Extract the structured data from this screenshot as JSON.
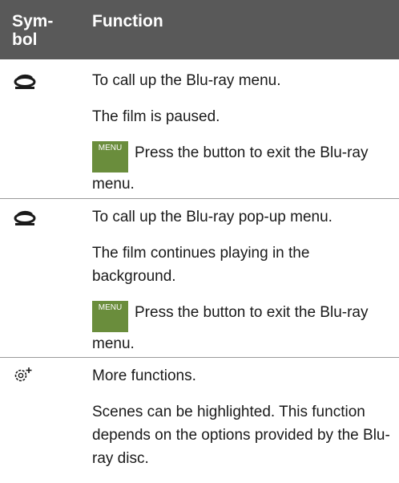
{
  "table": {
    "header_symbol": "Sym-\nbol",
    "header_function": "Function"
  },
  "rows": [
    {
      "icon": "bluray-disc-icon",
      "line1": "To call up the Blu-ray menu.",
      "line2": "The film is paused.",
      "menu_button": "MENU",
      "menu_text": "Press the button to exit the Blu-ray menu."
    },
    {
      "icon": "bluray-disc-icon",
      "line1": "To call up the Blu-ray pop-up menu.",
      "line2": "The film continues playing in the background.",
      "menu_button": "MENU",
      "menu_text": "Press the button to exit the Blu-ray menu."
    },
    {
      "icon": "settings-plus-icon",
      "line1": "More functions.",
      "line2": "Scenes can be highlighted. This function depends on the options provided by the Blu-ray disc."
    }
  ],
  "colors": {
    "header_bg": "#595959",
    "menu_button_bg": "#6a8d3c"
  }
}
